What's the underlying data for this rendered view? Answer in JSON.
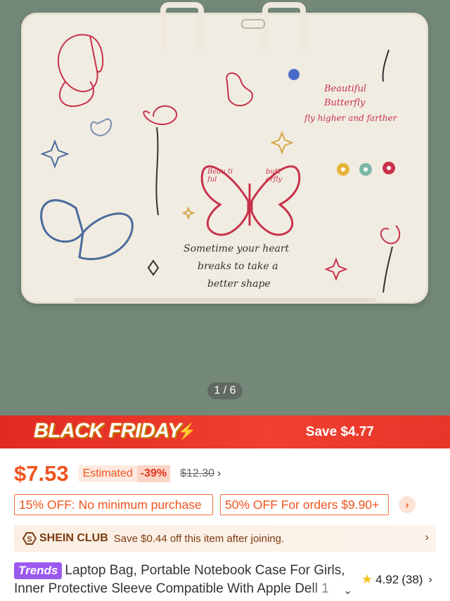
{
  "gallery": {
    "pager": "1 / 6",
    "bag_texts": {
      "beautiful": "Beautiful",
      "butterfly": "Butterfly",
      "fly_higher": "fly higher and farther",
      "quote_line1": "Sometime your heart",
      "quote_line2": "breaks to take a",
      "quote_line3": "better shape",
      "wing_left": "Beau ti ful",
      "wing_right": "butt erfly"
    }
  },
  "promo": {
    "title": "BLACK FRIDAY",
    "save": "Save $4.77"
  },
  "pricing": {
    "price": "$7.53",
    "estimated_label": "Estimated",
    "discount": "-39%",
    "original": "$12.30",
    "original_chevron": "›"
  },
  "coupons": [
    {
      "label": "15% OFF: No minimum purchase"
    },
    {
      "label": "50% OFF For orders $9.90+"
    }
  ],
  "coupon_more": "›",
  "club": {
    "name": "SHEIN CLUB",
    "text": "Save $0.44 off this item after joining.",
    "chevron": "›"
  },
  "product": {
    "badge": "Trends",
    "title": "Laptop Bag, Portable Notebook Case For Girls, Inner Protective Sleeve Compatible With Apple Dell 1",
    "expand": "⌄"
  },
  "rating": {
    "score": "4.92",
    "count": "(38)",
    "chevron": "›"
  },
  "colors": {
    "accent": "#f0551f",
    "promo_red": "#e02a23",
    "trends_purple": "#9b59f0",
    "hero_bg": "#738878"
  }
}
